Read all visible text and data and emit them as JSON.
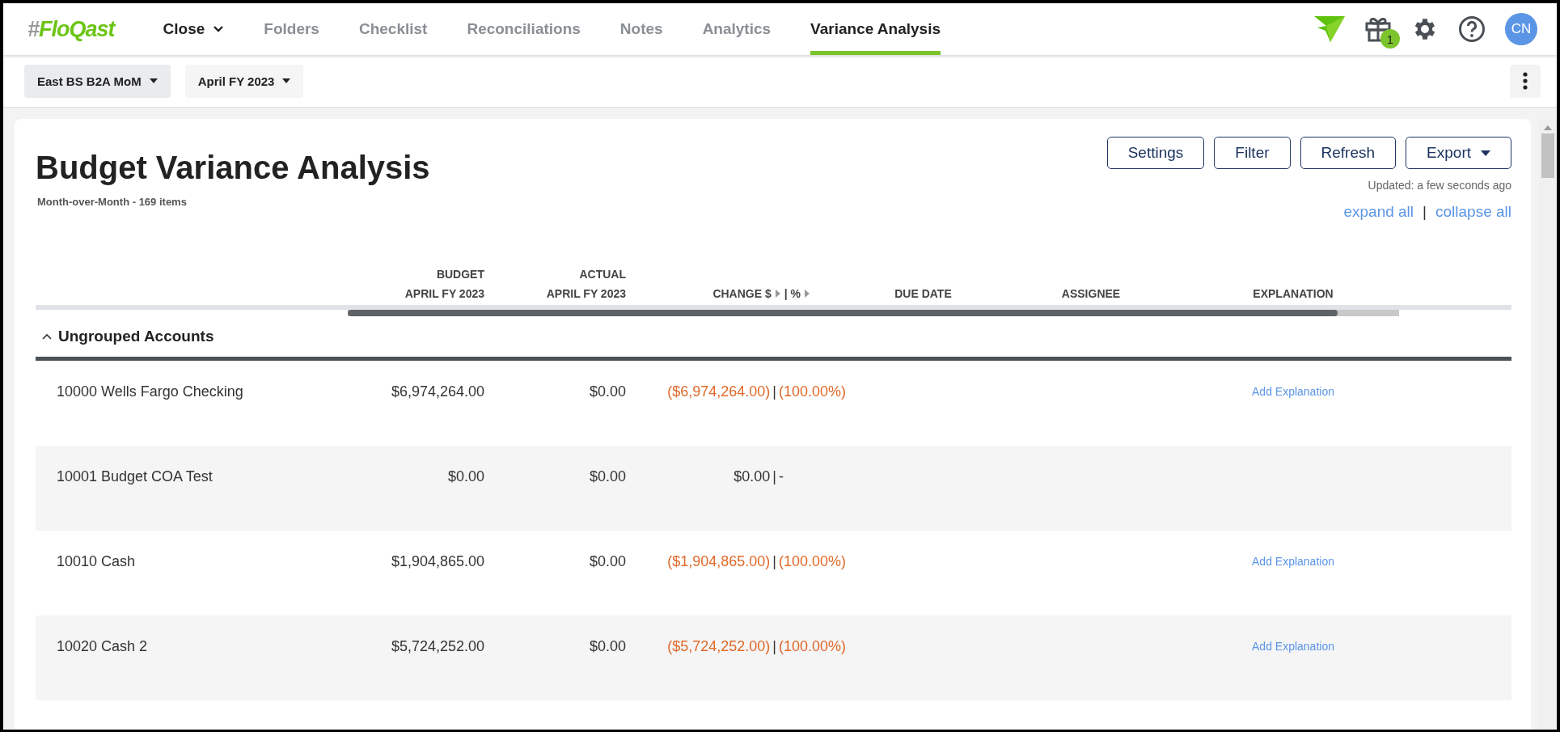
{
  "nav": {
    "logo": {
      "mark": "#",
      "name": "FloQast"
    },
    "tabs": [
      {
        "label": "Close",
        "kind": "module",
        "selected": false
      },
      {
        "label": "Folders",
        "kind": "tab",
        "selected": false
      },
      {
        "label": "Checklist",
        "kind": "tab",
        "selected": false
      },
      {
        "label": "Reconciliations",
        "kind": "tab",
        "selected": false
      },
      {
        "label": "Notes",
        "kind": "tab",
        "selected": false
      },
      {
        "label": "Analytics",
        "kind": "tab",
        "selected": false
      },
      {
        "label": "Variance Analysis",
        "kind": "tab",
        "selected": true
      }
    ],
    "gift_badge": "1",
    "avatar": "CN"
  },
  "filters": [
    {
      "label": "East BS B2A MoM",
      "active": true
    },
    {
      "label": "April FY 2023",
      "active": false
    }
  ],
  "page": {
    "title": "Budget Variance Analysis",
    "subtitle": "Month-over-Month - 169 items",
    "buttons": [
      {
        "label": "Settings",
        "kind": "plain"
      },
      {
        "label": "Filter",
        "kind": "plain"
      },
      {
        "label": "Refresh",
        "kind": "plain"
      },
      {
        "label": "Export",
        "kind": "menu"
      }
    ],
    "updated": "Updated: a few seconds ago",
    "expand_all": "expand all",
    "separator": "|",
    "collapse_all": "collapse all"
  },
  "table": {
    "columns": [
      {
        "kind": "stacked",
        "top": "BUDGET",
        "label": "APRIL FY 2023"
      },
      {
        "kind": "stacked",
        "top": "ACTUAL",
        "label": "APRIL FY 2023"
      },
      {
        "kind": "change",
        "label": "CHANGE $",
        "label2": "| %"
      },
      {
        "kind": "plain",
        "label": "DUE DATE"
      },
      {
        "kind": "plain",
        "label": "ASSIGNEE"
      },
      {
        "kind": "plain",
        "label": "EXPLANATION"
      }
    ],
    "group": {
      "label": "Ungrouped Accounts",
      "expanded": true
    },
    "rows": [
      {
        "account": "10000 Wells Fargo Checking",
        "budget": "$6,974,264.00",
        "actual": "$0.00",
        "change": "($6,974,264.00)",
        "percent": "(100.00%)",
        "separator": "|",
        "negative": true,
        "explanation": "Add Explanation"
      },
      {
        "account": "10001 Budget COA Test",
        "budget": "$0.00",
        "actual": "$0.00",
        "change": "$0.00",
        "percent": "-",
        "separator": "|",
        "negative": false
      },
      {
        "account": "10010 Cash",
        "budget": "$1,904,865.00",
        "actual": "$0.00",
        "change": "($1,904,865.00)",
        "percent": "(100.00%)",
        "separator": "|",
        "negative": true,
        "explanation": "Add Explanation"
      },
      {
        "account": "10020 Cash 2",
        "budget": "$5,724,252.00",
        "actual": "$0.00",
        "change": "($5,724,252.00)",
        "percent": "(100.00%)",
        "separator": "|",
        "negative": true,
        "explanation": "Add Explanation"
      }
    ]
  }
}
